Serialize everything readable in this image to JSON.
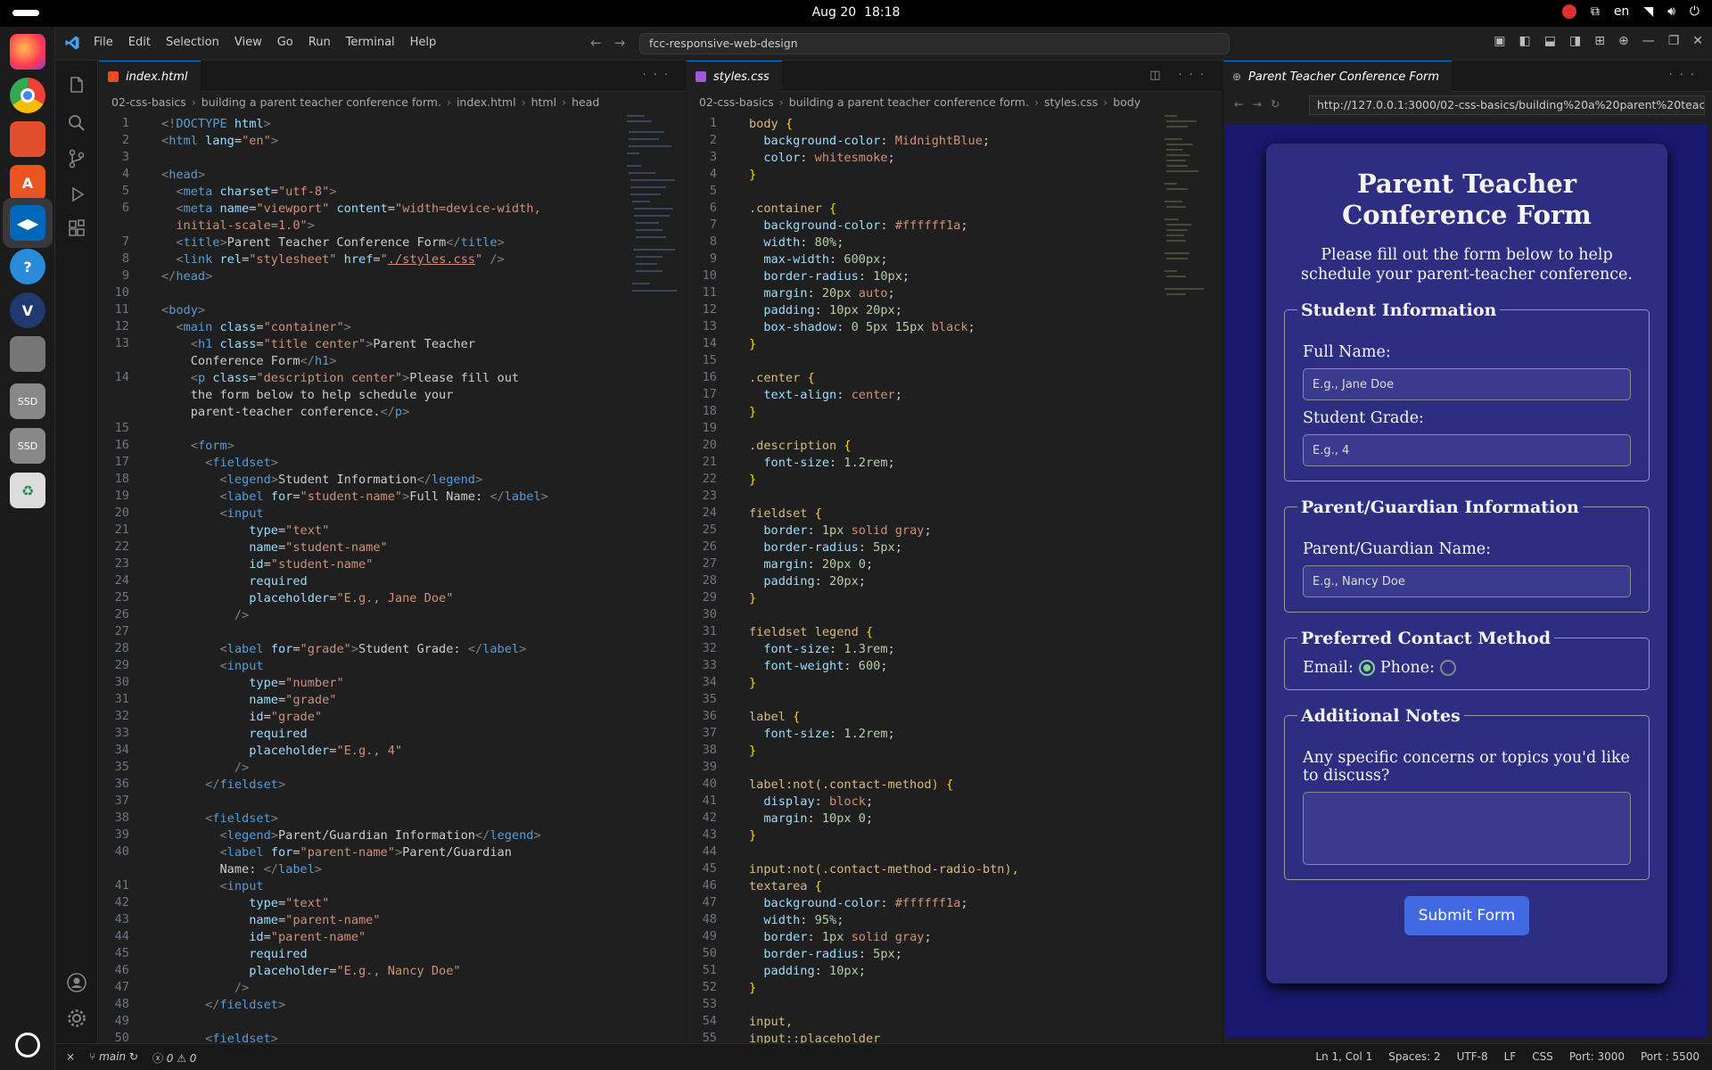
{
  "system": {
    "date": "Aug 20",
    "time": "18:18",
    "lang": "en"
  },
  "dock": [
    "Firefox",
    "Chrome",
    "Files",
    "App Center",
    "VS Code",
    "Help",
    "Vivaldi",
    "Text Editor",
    "SSD",
    "SSD",
    "Trash"
  ],
  "menu": [
    "File",
    "Edit",
    "Selection",
    "View",
    "Go",
    "Run",
    "Terminal",
    "Help"
  ],
  "command_center": "fcc-responsive-web-design",
  "left_editor": {
    "tab": "index.html",
    "breadcrumb": [
      "02-css-basics",
      "building a parent teacher conference form.",
      "index.html",
      "html",
      "head"
    ],
    "lines": [
      {
        "n": "1",
        "h": "<span class='g'>&lt;!</span><span class='t'>DOCTYPE</span> <span class='a'>html</span><span class='g'>&gt;</span>"
      },
      {
        "n": "2",
        "h": "<span class='g'>&lt;</span><span class='t'>html</span> <span class='a'>lang</span>=<span class='s'>\"en\"</span><span class='g'>&gt;</span>"
      },
      {
        "n": "3",
        "h": ""
      },
      {
        "n": "4",
        "h": "<span class='g'>&lt;</span><span class='t'>head</span><span class='g'>&gt;</span>"
      },
      {
        "n": "5",
        "h": "  <span class='g'>&lt;</span><span class='t'>meta</span> <span class='a'>charset</span>=<span class='s'>\"utf-8\"</span><span class='g'>&gt;</span>"
      },
      {
        "n": "6",
        "h": "  <span class='g'>&lt;</span><span class='t'>meta</span> <span class='a'>name</span>=<span class='s'>\"viewport\"</span> <span class='a'>content</span>=<span class='s'>\"width=device-width,</span>"
      },
      {
        "n": "",
        "h": "  <span class='s'>initial-scale=1.0\"</span><span class='g'>&gt;</span>"
      },
      {
        "n": "7",
        "h": "  <span class='g'>&lt;</span><span class='t'>title</span><span class='g'>&gt;</span>Parent Teacher Conference Form<span class='g'>&lt;/</span><span class='t'>title</span><span class='g'>&gt;</span>"
      },
      {
        "n": "8",
        "h": "  <span class='g'>&lt;</span><span class='t'>link</span> <span class='a'>rel</span>=<span class='s'>\"stylesheet\"</span> <span class='a'>href</span>=<span class='s'>\"<u>./styles.css</u>\"</span> <span class='g'>/&gt;</span>"
      },
      {
        "n": "9",
        "h": "<span class='g'>&lt;/</span><span class='t'>head</span><span class='g'>&gt;</span>"
      },
      {
        "n": "10",
        "h": ""
      },
      {
        "n": "11",
        "h": "<span class='g'>&lt;</span><span class='t'>body</span><span class='g'>&gt;</span>"
      },
      {
        "n": "12",
        "h": "  <span class='g'>&lt;</span><span class='t'>main</span> <span class='a'>class</span>=<span class='s'>\"container\"</span><span class='g'>&gt;</span>"
      },
      {
        "n": "13",
        "h": "    <span class='g'>&lt;</span><span class='t'>h1</span> <span class='a'>class</span>=<span class='s'>\"title center\"</span><span class='g'>&gt;</span>Parent Teacher"
      },
      {
        "n": "",
        "h": "    Conference Form<span class='g'>&lt;/</span><span class='t'>h1</span><span class='g'>&gt;</span>"
      },
      {
        "n": "14",
        "h": "    <span class='g'>&lt;</span><span class='t'>p</span> <span class='a'>class</span>=<span class='s'>\"description center\"</span><span class='g'>&gt;</span>Please fill out"
      },
      {
        "n": "",
        "h": "    the form below to help schedule your"
      },
      {
        "n": "",
        "h": "    parent-teacher conference.<span class='g'>&lt;/</span><span class='t'>p</span><span class='g'>&gt;</span>"
      },
      {
        "n": "15",
        "h": ""
      },
      {
        "n": "16",
        "h": "    <span class='g'>&lt;</span><span class='t'>form</span><span class='g'>&gt;</span>"
      },
      {
        "n": "17",
        "h": "      <span class='g'>&lt;</span><span class='t'>fieldset</span><span class='g'>&gt;</span>"
      },
      {
        "n": "18",
        "h": "        <span class='g'>&lt;</span><span class='t'>legend</span><span class='g'>&gt;</span>Student Information<span class='g'>&lt;/</span><span class='t'>legend</span><span class='g'>&gt;</span>"
      },
      {
        "n": "19",
        "h": "        <span class='g'>&lt;</span><span class='t'>label</span> <span class='a'>for</span>=<span class='s'>\"student-name\"</span><span class='g'>&gt;</span>Full Name: <span class='g'>&lt;/</span><span class='t'>label</span><span class='g'>&gt;</span>"
      },
      {
        "n": "20",
        "h": "        <span class='g'>&lt;</span><span class='t'>input</span>"
      },
      {
        "n": "21",
        "h": "            <span class='a'>type</span>=<span class='s'>\"text\"</span>"
      },
      {
        "n": "22",
        "h": "            <span class='a'>name</span>=<span class='s'>\"student-name\"</span>"
      },
      {
        "n": "23",
        "h": "            <span class='a'>id</span>=<span class='s'>\"student-name\"</span>"
      },
      {
        "n": "24",
        "h": "            <span class='a'>required</span>"
      },
      {
        "n": "25",
        "h": "            <span class='a'>placeholder</span>=<span class='s'>\"E.g., Jane Doe\"</span>"
      },
      {
        "n": "26",
        "h": "          <span class='g'>/&gt;</span>"
      },
      {
        "n": "27",
        "h": ""
      },
      {
        "n": "28",
        "h": "        <span class='g'>&lt;</span><span class='t'>label</span> <span class='a'>for</span>=<span class='s'>\"grade\"</span><span class='g'>&gt;</span>Student Grade: <span class='g'>&lt;/</span><span class='t'>label</span><span class='g'>&gt;</span>"
      },
      {
        "n": "29",
        "h": "        <span class='g'>&lt;</span><span class='t'>input</span>"
      },
      {
        "n": "30",
        "h": "            <span class='a'>type</span>=<span class='s'>\"number\"</span>"
      },
      {
        "n": "31",
        "h": "            <span class='a'>name</span>=<span class='s'>\"grade\"</span>"
      },
      {
        "n": "32",
        "h": "            <span class='a'>id</span>=<span class='s'>\"grade\"</span>"
      },
      {
        "n": "33",
        "h": "            <span class='a'>required</span>"
      },
      {
        "n": "34",
        "h": "            <span class='a'>placeholder</span>=<span class='s'>\"E.g., 4\"</span>"
      },
      {
        "n": "35",
        "h": "          <span class='g'>/&gt;</span>"
      },
      {
        "n": "36",
        "h": "      <span class='g'>&lt;/</span><span class='t'>fieldset</span><span class='g'>&gt;</span>"
      },
      {
        "n": "37",
        "h": ""
      },
      {
        "n": "38",
        "h": "      <span class='g'>&lt;</span><span class='t'>fieldset</span><span class='g'>&gt;</span>"
      },
      {
        "n": "39",
        "h": "        <span class='g'>&lt;</span><span class='t'>legend</span><span class='g'>&gt;</span>Parent/Guardian Information<span class='g'>&lt;/</span><span class='t'>legend</span><span class='g'>&gt;</span>"
      },
      {
        "n": "40",
        "h": "        <span class='g'>&lt;</span><span class='t'>label</span> <span class='a'>for</span>=<span class='s'>\"parent-name\"</span><span class='g'>&gt;</span>Parent/Guardian"
      },
      {
        "n": "",
        "h": "        Name: <span class='g'>&lt;/</span><span class='t'>label</span><span class='g'>&gt;</span>"
      },
      {
        "n": "41",
        "h": "        <span class='g'>&lt;</span><span class='t'>input</span>"
      },
      {
        "n": "42",
        "h": "            <span class='a'>type</span>=<span class='s'>\"text\"</span>"
      },
      {
        "n": "43",
        "h": "            <span class='a'>name</span>=<span class='s'>\"parent-name\"</span>"
      },
      {
        "n": "44",
        "h": "            <span class='a'>id</span>=<span class='s'>\"parent-name\"</span>"
      },
      {
        "n": "45",
        "h": "            <span class='a'>required</span>"
      },
      {
        "n": "46",
        "h": "            <span class='a'>placeholder</span>=<span class='s'>\"E.g., Nancy Doe\"</span>"
      },
      {
        "n": "47",
        "h": "          <span class='g'>/&gt;</span>"
      },
      {
        "n": "48",
        "h": "      <span class='g'>&lt;/</span><span class='t'>fieldset</span><span class='g'>&gt;</span>"
      },
      {
        "n": "49",
        "h": ""
      },
      {
        "n": "50",
        "h": "      <span class='g'>&lt;</span><span class='t'>fieldset</span><span class='g'>&gt;</span>"
      }
    ]
  },
  "right_editor": {
    "tab": "styles.css",
    "breadcrumb": [
      "02-css-basics",
      "building a parent teacher conference form.",
      "styles.css",
      "body"
    ],
    "lines": [
      {
        "n": "1",
        "h": "<span class='y'>body</span> <span class='p'>{</span>"
      },
      {
        "n": "2",
        "h": "  <span class='a'>background-color</span>: <span class='s'>MidnightBlue</span>;"
      },
      {
        "n": "3",
        "h": "  <span class='a'>color</span>: <span class='s'>whitesmoke</span>;"
      },
      {
        "n": "4",
        "h": "<span class='p'>}</span>"
      },
      {
        "n": "5",
        "h": ""
      },
      {
        "n": "6",
        "h": "<span class='y'>.container</span> <span class='p'>{</span>"
      },
      {
        "n": "7",
        "h": "  <span class='a'>background-color</span>: <span class='s'>#ffffff1a</span>;"
      },
      {
        "n": "8",
        "h": "  <span class='a'>width</span>: <span class='n'>80%</span>;"
      },
      {
        "n": "9",
        "h": "  <span class='a'>max-width</span>: <span class='n'>600px</span>;"
      },
      {
        "n": "10",
        "h": "  <span class='a'>border-radius</span>: <span class='n'>10px</span>;"
      },
      {
        "n": "11",
        "h": "  <span class='a'>margin</span>: <span class='n'>20px</span> <span class='s'>auto</span>;"
      },
      {
        "n": "12",
        "h": "  <span class='a'>padding</span>: <span class='n'>10px 20px</span>;"
      },
      {
        "n": "13",
        "h": "  <span class='a'>box-shadow</span>: <span class='n'>0 5px 15px</span> <span class='s'>black</span>;"
      },
      {
        "n": "14",
        "h": "<span class='p'>}</span>"
      },
      {
        "n": "15",
        "h": ""
      },
      {
        "n": "16",
        "h": "<span class='y'>.center</span> <span class='p'>{</span>"
      },
      {
        "n": "17",
        "h": "  <span class='a'>text-align</span>: <span class='s'>center</span>;"
      },
      {
        "n": "18",
        "h": "<span class='p'>}</span>"
      },
      {
        "n": "19",
        "h": ""
      },
      {
        "n": "20",
        "h": "<span class='y'>.description</span> <span class='p'>{</span>"
      },
      {
        "n": "21",
        "h": "  <span class='a'>font-size</span>: <span class='n'>1.2rem</span>;"
      },
      {
        "n": "22",
        "h": "<span class='p'>}</span>"
      },
      {
        "n": "23",
        "h": ""
      },
      {
        "n": "24",
        "h": "<span class='y'>fieldset</span> <span class='p'>{</span>"
      },
      {
        "n": "25",
        "h": "  <span class='a'>border</span>: <span class='n'>1px</span> <span class='s'>solid</span> <span class='s'>gray</span>;"
      },
      {
        "n": "26",
        "h": "  <span class='a'>border-radius</span>: <span class='n'>5px</span>;"
      },
      {
        "n": "27",
        "h": "  <span class='a'>margin</span>: <span class='n'>20px 0</span>;"
      },
      {
        "n": "28",
        "h": "  <span class='a'>padding</span>: <span class='n'>20px</span>;"
      },
      {
        "n": "29",
        "h": "<span class='p'>}</span>"
      },
      {
        "n": "30",
        "h": ""
      },
      {
        "n": "31",
        "h": "<span class='y'>fieldset legend</span> <span class='p'>{</span>"
      },
      {
        "n": "32",
        "h": "  <span class='a'>font-size</span>: <span class='n'>1.3rem</span>;"
      },
      {
        "n": "33",
        "h": "  <span class='a'>font-weight</span>: <span class='n'>600</span>;"
      },
      {
        "n": "34",
        "h": "<span class='p'>}</span>"
      },
      {
        "n": "35",
        "h": ""
      },
      {
        "n": "36",
        "h": "<span class='y'>label</span> <span class='p'>{</span>"
      },
      {
        "n": "37",
        "h": "  <span class='a'>font-size</span>: <span class='n'>1.2rem</span>;"
      },
      {
        "n": "38",
        "h": "<span class='p'>}</span>"
      },
      {
        "n": "39",
        "h": ""
      },
      {
        "n": "40",
        "h": "<span class='y'>label:not(.contact-method)</span> <span class='p'>{</span>"
      },
      {
        "n": "41",
        "h": "  <span class='a'>display</span>: <span class='s'>block</span>;"
      },
      {
        "n": "42",
        "h": "  <span class='a'>margin</span>: <span class='n'>10px 0</span>;"
      },
      {
        "n": "43",
        "h": "<span class='p'>}</span>"
      },
      {
        "n": "44",
        "h": ""
      },
      {
        "n": "45",
        "h": "<span class='y'>input:not(.contact-method-radio-btn),</span>"
      },
      {
        "n": "46",
        "h": "<span class='y'>textarea</span> <span class='p'>{</span>"
      },
      {
        "n": "47",
        "h": "  <span class='a'>background-color</span>: <span class='s'>#ffffff1a</span>;"
      },
      {
        "n": "48",
        "h": "  <span class='a'>width</span>: <span class='n'>95%</span>;"
      },
      {
        "n": "49",
        "h": "  <span class='a'>border</span>: <span class='n'>1px</span> <span class='s'>solid</span> <span class='s'>gray</span>;"
      },
      {
        "n": "50",
        "h": "  <span class='a'>border-radius</span>: <span class='n'>5px</span>;"
      },
      {
        "n": "51",
        "h": "  <span class='a'>padding</span>: <span class='n'>10px</span>;"
      },
      {
        "n": "52",
        "h": "<span class='p'>}</span>"
      },
      {
        "n": "53",
        "h": ""
      },
      {
        "n": "54",
        "h": "<span class='y'>input,</span>"
      },
      {
        "n": "55",
        "h": "<span class='y'>input::placeholder</span>"
      }
    ]
  },
  "browser": {
    "tab": "Parent Teacher Conference Form",
    "url": "http://127.0.0.1:3000/02-css-basics/building%20a%20parent%20teach...",
    "page": {
      "title": "Parent Teacher Conference Form",
      "description": "Please fill out the form below to help schedule your parent-teacher conference.",
      "student_legend": "Student Information",
      "full_name_label": "Full Name:",
      "full_name_placeholder": "E.g., Jane Doe",
      "grade_label": "Student Grade:",
      "grade_placeholder": "E.g., 4",
      "parent_legend": "Parent/Guardian Information",
      "parent_label": "Parent/Guardian Name:",
      "parent_placeholder": "E.g., Nancy Doe",
      "contact_legend": "Preferred Contact Method",
      "email_label": "Email:",
      "phone_label": "Phone:",
      "contact_selected": "Email",
      "notes_legend": "Additional Notes",
      "notes_label": "Any specific concerns or topics you'd like to discuss?",
      "submit": "Submit Form"
    }
  },
  "status": {
    "branch": "main",
    "errors": "0",
    "warnings": "0",
    "cursor": "Ln 1, Col 1",
    "spaces": "Spaces: 2",
    "encoding": "UTF-8",
    "eol": "LF",
    "language": "CSS",
    "port1": "Port: 3000",
    "port2": "Port : 5500"
  },
  "colors": {
    "accent": "#0078d4",
    "page_bg": "#191970",
    "submit": "#4169e1"
  }
}
